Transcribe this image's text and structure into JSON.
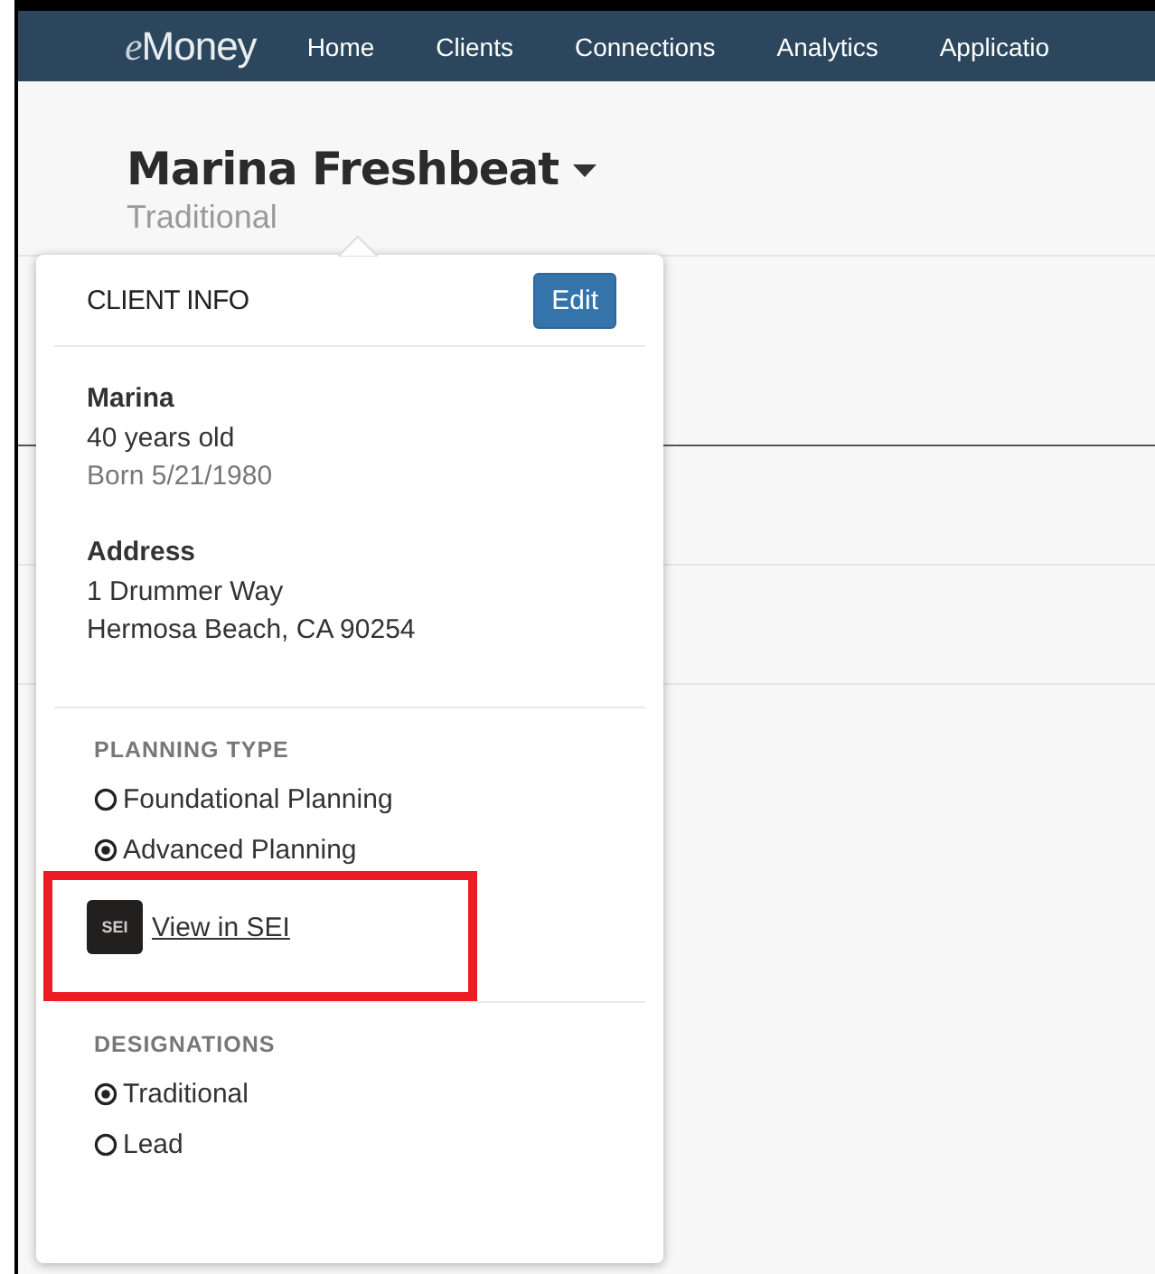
{
  "nav": {
    "logo": "eMoney",
    "items": [
      "Home",
      "Clients",
      "Connections",
      "Analytics",
      "Applicatio"
    ]
  },
  "client": {
    "name": "Marina Freshbeat",
    "designation": "Traditional"
  },
  "popover": {
    "title": "CLIENT INFO",
    "edit_button": "Edit",
    "person": {
      "first_name": "Marina",
      "age": "40 years old",
      "born": "Born 5/21/1980"
    },
    "address": {
      "label": "Address",
      "lines": [
        "1 Drummer Way",
        "Hermosa Beach, CA 90254"
      ]
    },
    "planning_type": {
      "label": "PLANNING TYPE",
      "options": [
        {
          "label": "Foundational Planning",
          "selected": false
        },
        {
          "label": "Advanced Planning",
          "selected": true
        }
      ]
    },
    "sei_link": {
      "logo": "SEI",
      "label": "View in SEI"
    },
    "designations": {
      "label": "DESIGNATIONS",
      "options": [
        {
          "label": "Traditional",
          "selected": true
        },
        {
          "label": "Lead",
          "selected": false
        }
      ]
    }
  }
}
